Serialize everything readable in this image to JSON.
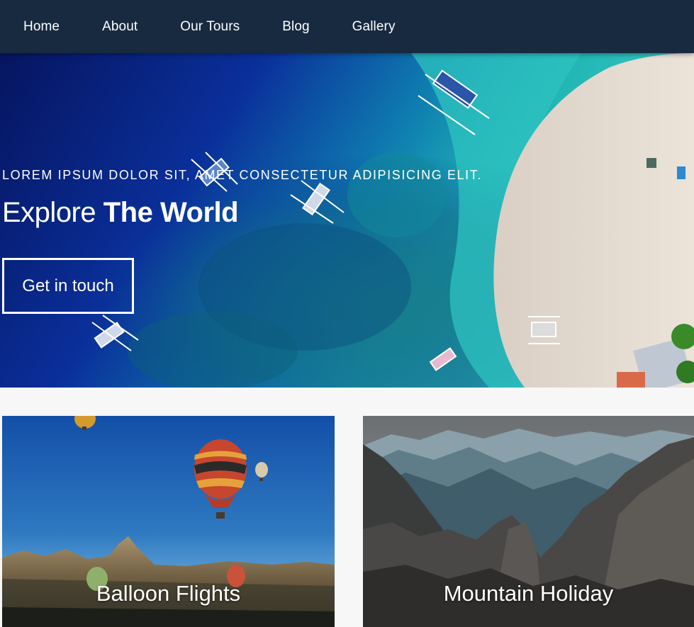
{
  "nav": {
    "items": [
      {
        "label": "Home"
      },
      {
        "label": "About"
      },
      {
        "label": "Our Tours"
      },
      {
        "label": "Blog"
      },
      {
        "label": "Gallery"
      }
    ]
  },
  "hero": {
    "tagline": "LOREM IPSUM DOLOR SIT, AMET CONSECTETUR ADIPISICING ELIT.",
    "title_regular": "Explore",
    "title_bold": "The World",
    "cta_label": "Get in touch"
  },
  "cards": [
    {
      "title": "Balloon Flights"
    },
    {
      "title": "Mountain Holiday"
    }
  ],
  "colors": {
    "nav_background": "#172a40",
    "page_background": "#f7f7f7",
    "text": "#ffffff"
  }
}
